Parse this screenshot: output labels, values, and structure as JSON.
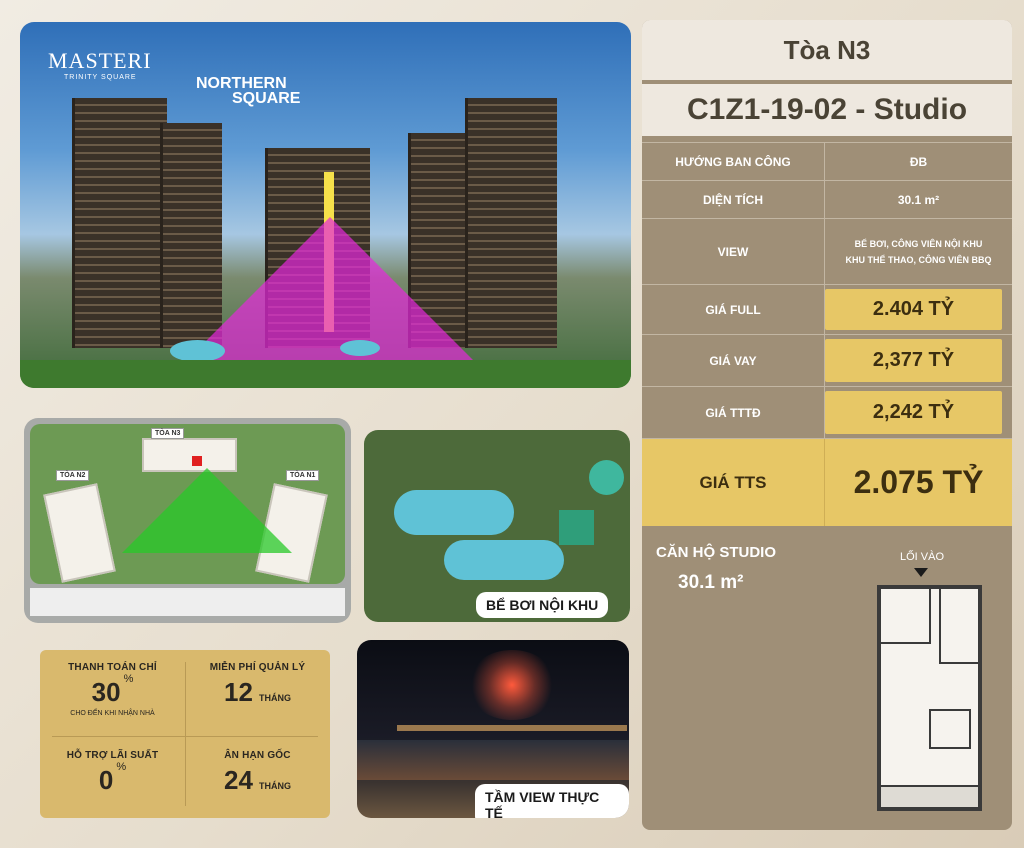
{
  "hero": {
    "logo_masteri": "MASTERI",
    "logo_masteri_sub": "TRINITY SQUARE",
    "logo_northern_1": "NORTHERN",
    "logo_northern_2": "SQUARE"
  },
  "site_plan": {
    "labels": [
      "TÒA N3",
      "TÒA N2",
      "TÒA N1"
    ]
  },
  "pool": {
    "caption": "BỂ BƠI NỘI KHU"
  },
  "night": {
    "caption": "TẦM VIEW THỰC TẾ"
  },
  "promo": {
    "cells": [
      {
        "label": "THANH TOÁN CHỈ",
        "value": "30",
        "sup": "%",
        "sub": "CHO ĐẾN KHI NHẬN NHÀ"
      },
      {
        "label": "MIỄN PHÍ QUẢN LÝ",
        "value": "12",
        "unit": "THÁNG"
      },
      {
        "label": "HỖ TRỢ LÃI SUẤT",
        "value": "0",
        "sup": "%"
      },
      {
        "label": "ÂN HẠN GỐC",
        "value": "24",
        "unit": "THÁNG"
      }
    ]
  },
  "info": {
    "building": "Tòa N3",
    "unit_code": "C1Z1-19-02 - Studio",
    "rows": [
      {
        "k": "HƯỚNG BAN CÔNG",
        "v": "ĐB"
      },
      {
        "k": "DIỆN TÍCH",
        "v": "30.1 m²"
      },
      {
        "k": "VIEW",
        "v": "BỂ BƠI, CÔNG VIÊN NỘI KHU",
        "v2": "KHU THỂ THAO, CÔNG VIÊN BBQ"
      }
    ],
    "prices": [
      {
        "k": "GIÁ FULL",
        "v": "2.404 TỶ"
      },
      {
        "k": "GIÁ VAY",
        "v": "2,377 TỶ"
      },
      {
        "k": "GIÁ TTTĐ",
        "v": "2,242 TỶ"
      }
    ],
    "tts": {
      "k": "GIÁ TTS",
      "v": "2.075 TỶ"
    },
    "studio_title": "CĂN HỘ STUDIO",
    "studio_area": "30.1 m²",
    "entrance": "LỐI VÀO"
  }
}
